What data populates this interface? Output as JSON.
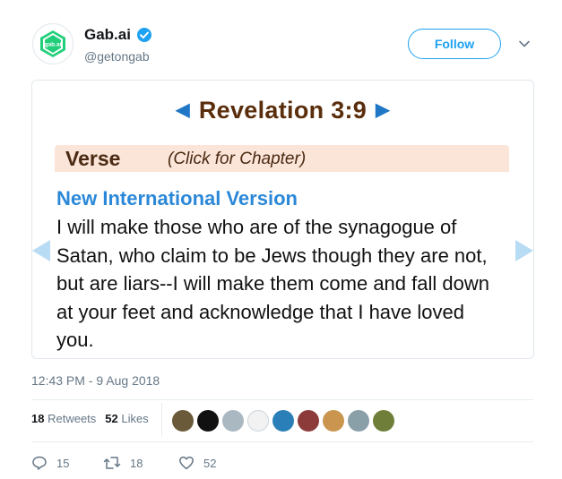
{
  "account": {
    "display_name": "Gab.ai",
    "handle": "@getongab",
    "avatar_text": "gab.ai",
    "follow_label": "Follow"
  },
  "media": {
    "reference": "Revelation 3:9",
    "verse_label": "Verse",
    "verse_hint": "(Click for Chapter)",
    "version": "New International Version",
    "verse_text": "I will make those who are of the synagogue of Satan, who claim to be Jews though they are not, but are liars--I will make them come and fall down at your feet and acknowledge that I have loved you."
  },
  "tweet": {
    "timestamp": "12:43 PM - 9 Aug 2018",
    "retweets_count": "18",
    "retweets_label": "Retweets",
    "likes_count": "52",
    "likes_label": "Likes"
  },
  "likers": [
    {
      "color": "#6b5a3a"
    },
    {
      "color": "#111111"
    },
    {
      "color": "#aab8c2"
    },
    {
      "color": "#f2f2f2"
    },
    {
      "color": "#2a7fb8"
    },
    {
      "color": "#8c3a3a"
    },
    {
      "color": "#c9954f"
    },
    {
      "color": "#8aa0a8"
    },
    {
      "color": "#6f7f3a"
    }
  ],
  "actions": {
    "replies": "15",
    "retweets": "18",
    "likes": "52"
  },
  "colors": {
    "accent": "#1da1f2",
    "brand_green": "#21cf7a",
    "verse_brown": "#5a2e0c",
    "version_blue": "#2b88d8"
  }
}
